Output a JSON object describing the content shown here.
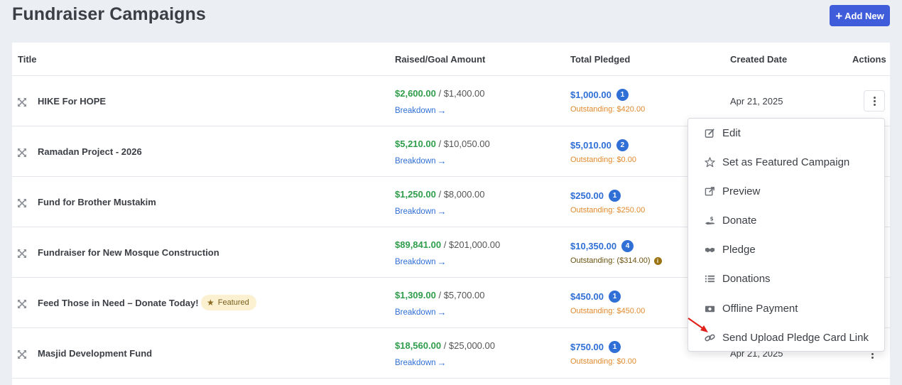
{
  "page": {
    "title": "Fundraiser Campaigns",
    "add_button_label": "Add New"
  },
  "table": {
    "headers": {
      "title": "Title",
      "raised": "Raised/Goal Amount",
      "pledged": "Total Pledged",
      "created": "Created Date",
      "actions": "Actions"
    },
    "breakdown_label": "Breakdown",
    "rows": [
      {
        "title": "HIKE For HOPE",
        "raised": "$2,600.00",
        "goal": "$1,400.00",
        "pledged": "$1,000.00",
        "pledge_count": "1",
        "outstanding": "Outstanding: $420.00",
        "created": "Apr 21, 2025"
      },
      {
        "title": "Ramadan Project - 2026",
        "raised": "$5,210.00",
        "goal": "$10,050.00",
        "pledged": "$5,010.00",
        "pledge_count": "2",
        "outstanding": "Outstanding: $0.00",
        "created": ""
      },
      {
        "title": "Fund for Brother Mustakim",
        "raised": "$1,250.00",
        "goal": "$8,000.00",
        "pledged": "$250.00",
        "pledge_count": "1",
        "outstanding": "Outstanding: $250.00",
        "created": ""
      },
      {
        "title": "Fundraiser for New Mosque Construction",
        "raised": "$89,841.00",
        "goal": "$201,000.00",
        "pledged": "$10,350.00",
        "pledge_count": "4",
        "outstanding": "Outstanding: ($314.00)",
        "created": ""
      },
      {
        "title": "Feed Those in Need – Donate Today!",
        "featured_label": "Featured",
        "raised": "$1,309.00",
        "goal": "$5,700.00",
        "pledged": "$450.00",
        "pledge_count": "1",
        "outstanding": "Outstanding: $450.00",
        "created": ""
      },
      {
        "title": "Masjid Development Fund",
        "raised": "$18,560.00",
        "goal": "$25,000.00",
        "pledged": "$750.00",
        "pledge_count": "1",
        "outstanding": "Outstanding: $0.00",
        "created": "Apr 21, 2025"
      }
    ]
  },
  "actions_menu": {
    "items": [
      {
        "label": "Edit",
        "icon": "edit-icon"
      },
      {
        "label": "Set as Featured Campaign",
        "icon": "star-icon"
      },
      {
        "label": "Preview",
        "icon": "external-link-icon"
      },
      {
        "label": "Donate",
        "icon": "donate-hand-icon"
      },
      {
        "label": "Pledge",
        "icon": "handshake-icon"
      },
      {
        "label": "Donations",
        "icon": "list-icon"
      },
      {
        "label": "Offline Payment",
        "icon": "money-bill-icon"
      },
      {
        "label": "Send Upload Pledge Card Link",
        "icon": "link-icon"
      }
    ]
  },
  "colors": {
    "accent": "#3f5ddb",
    "raised_green": "#2f9d4b",
    "link_blue": "#2f6fd6",
    "outstanding_orange": "#e08a2c",
    "annotation_red": "#e0201b"
  }
}
